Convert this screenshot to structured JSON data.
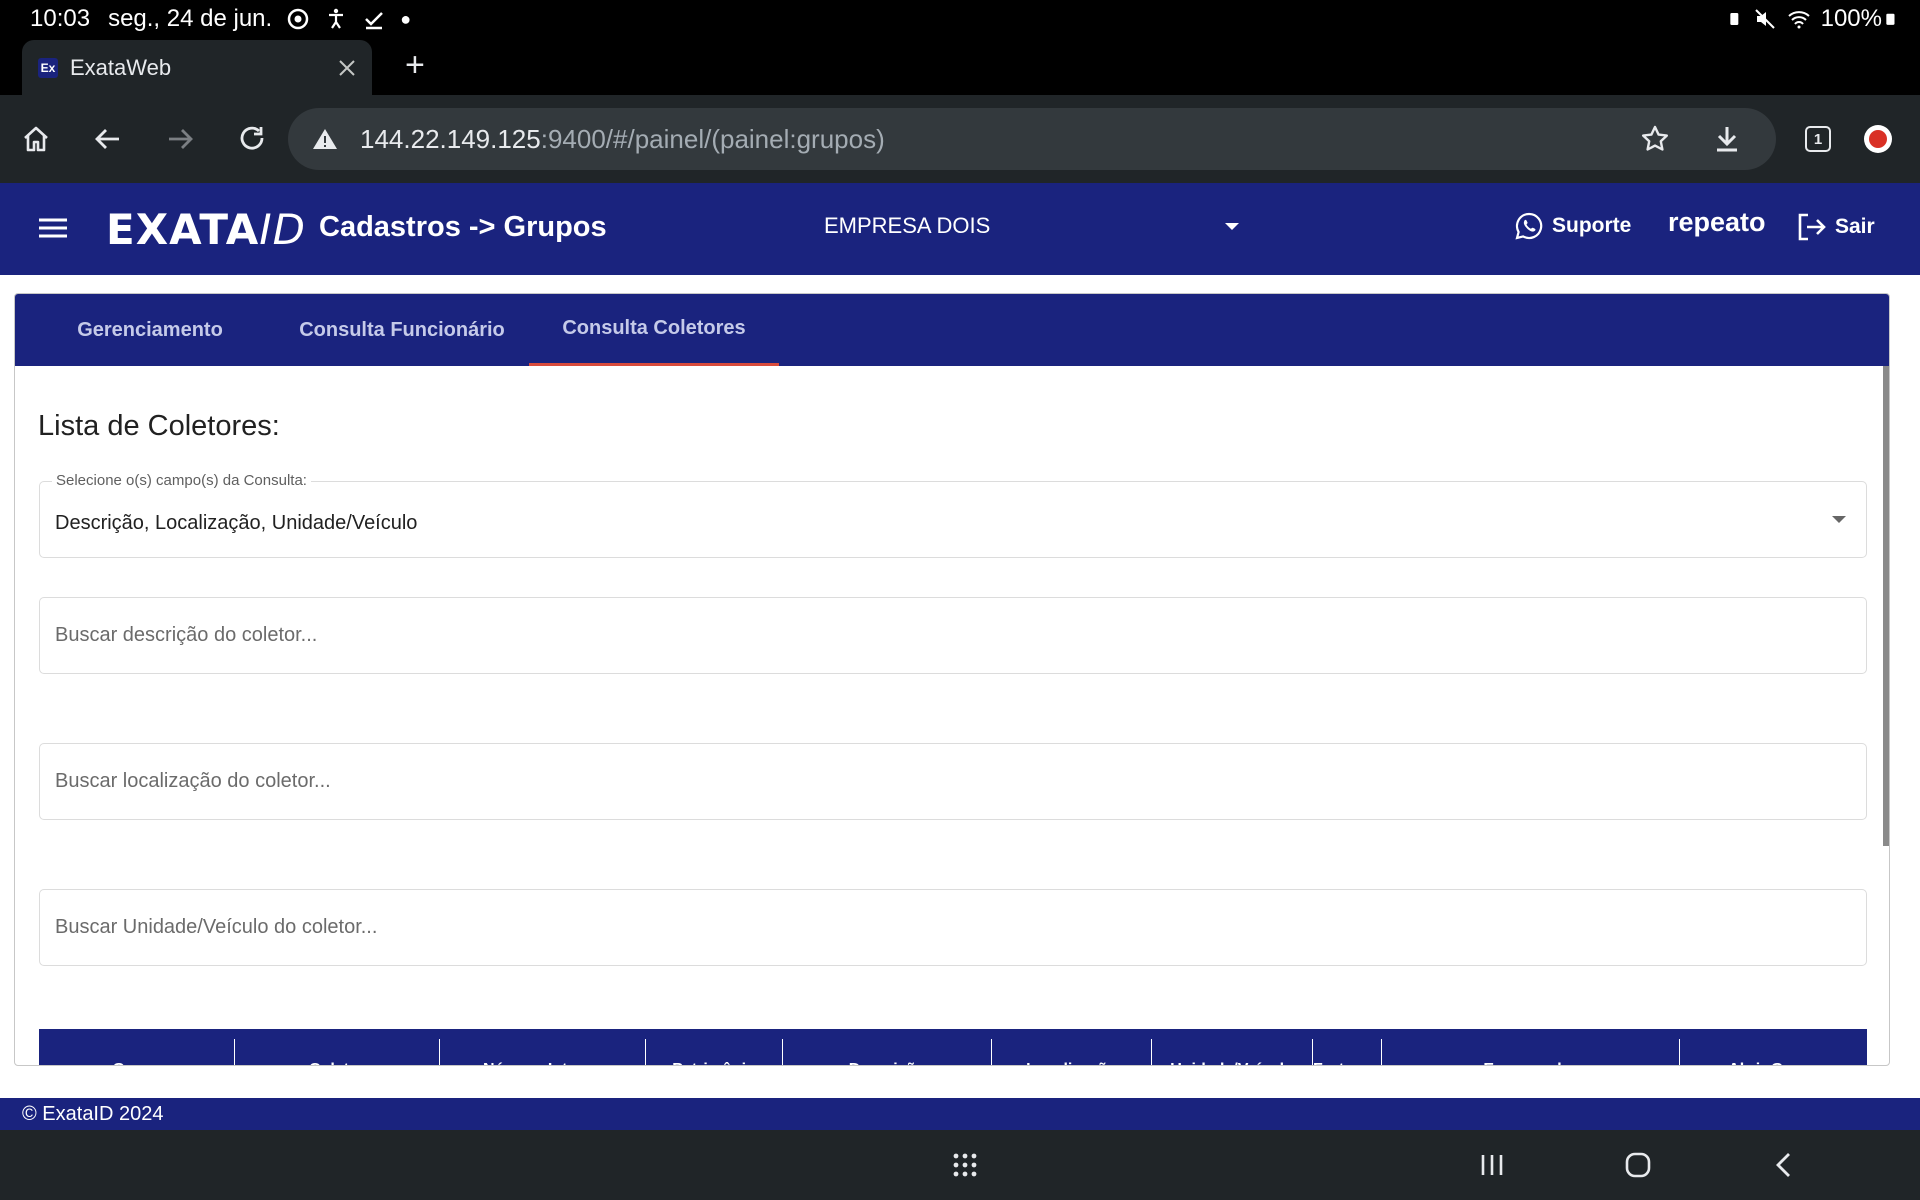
{
  "status_bar": {
    "time": "10:03",
    "date": "seg., 24 de jun.",
    "battery": "100%"
  },
  "browser": {
    "tab_title": "ExataWeb",
    "favicon_text": "Ex",
    "url_host": "144.22.149.125",
    "url_path": ":9400/#/painel/(painel:grupos)",
    "tab_count": "1"
  },
  "header": {
    "logo_main": "EXATA",
    "logo_suffix": "ID",
    "page_title": "Cadastros -> Grupos",
    "company": "EMPRESA DOIS",
    "support_label": "Suporte",
    "username": "repeato",
    "logout_label": "Sair"
  },
  "tabs": [
    {
      "label": "Gerenciamento"
    },
    {
      "label": "Consulta Funcionário"
    },
    {
      "label": "Consulta Coletores"
    }
  ],
  "active_tab": "Consulta Coletores",
  "list_title": "Lista de Coletores:",
  "select": {
    "label": "Selecione o(s) campo(s) da Consulta:",
    "value": "Descrição, Localização, Unidade/Veículo"
  },
  "search": {
    "descricao_placeholder": "Buscar descrição do coletor...",
    "localizacao_placeholder": "Buscar localização do coletor...",
    "unidade_placeholder": "Buscar Unidade/Veículo do coletor..."
  },
  "table": {
    "columns": [
      "Grupo",
      "Coletor",
      "Número Interno",
      "Patrimônio",
      "Descrição",
      "Localização",
      "Unidade/Veículo",
      "Frota",
      "Empregador",
      "Abrir Grupo"
    ]
  },
  "footer": {
    "text": "© ExataID 2024"
  },
  "colors": {
    "primary": "#1a237e",
    "tab_indicator": "#d84b3c",
    "browser_chrome": "#202528"
  }
}
